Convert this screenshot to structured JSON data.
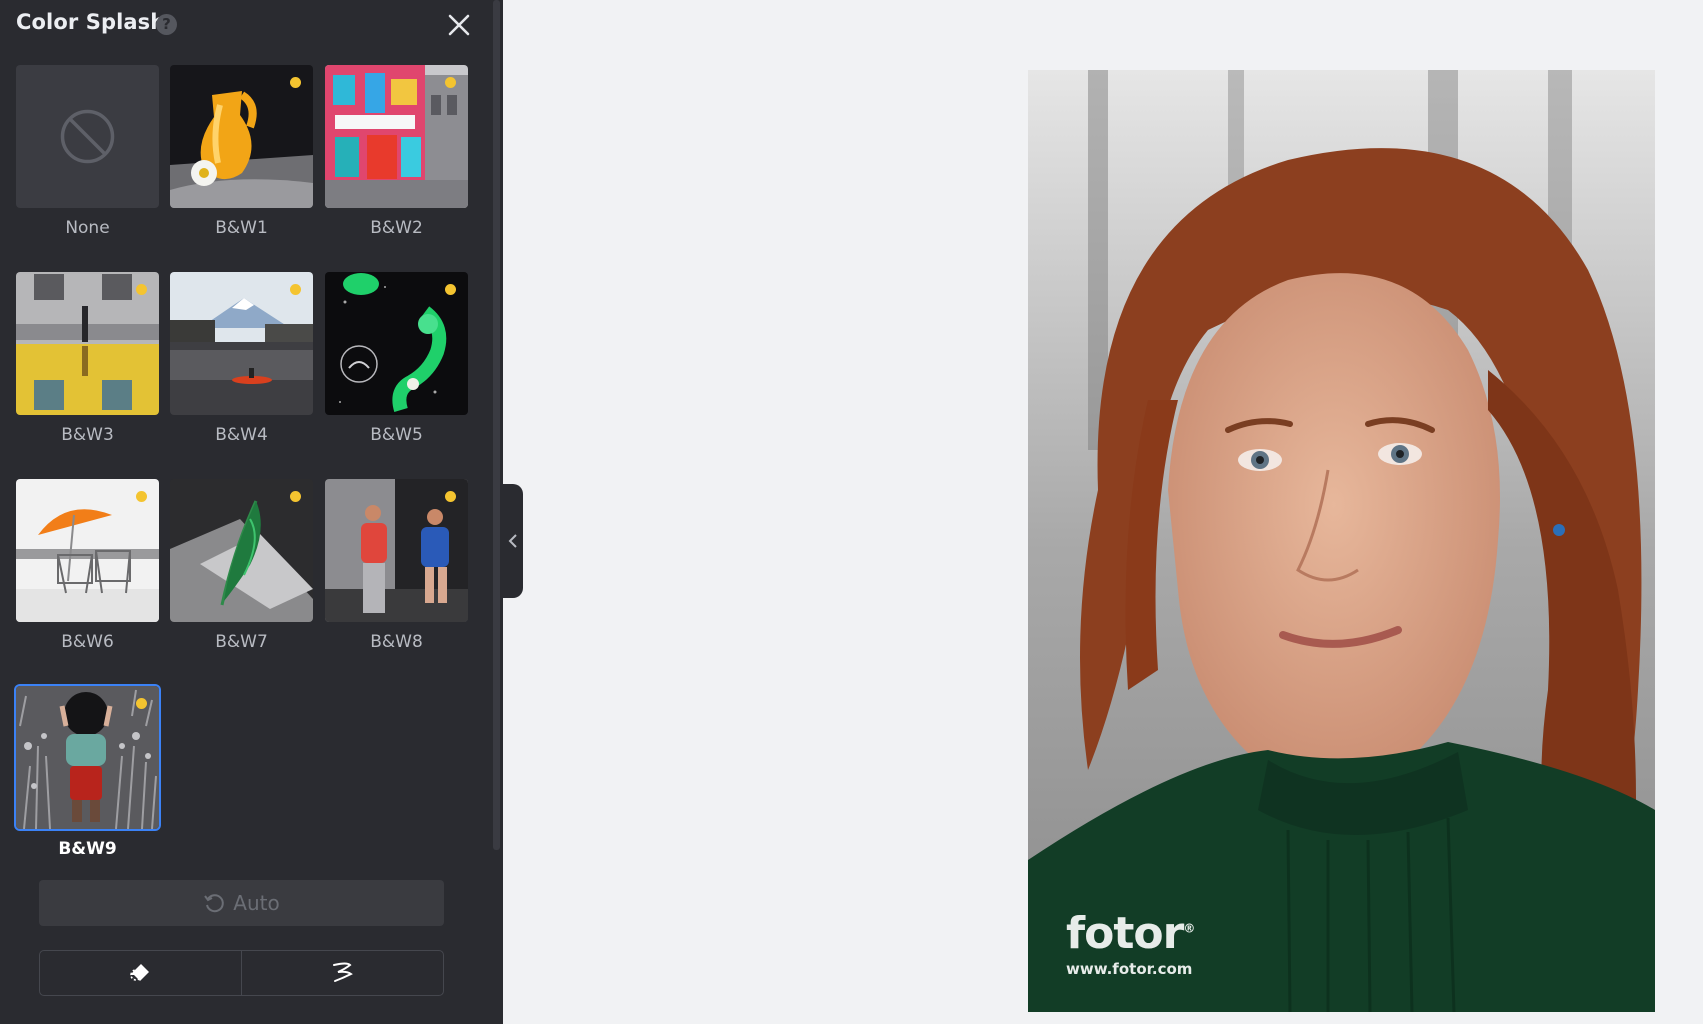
{
  "panel": {
    "title": "Color Splash",
    "help_icon": "question-mark-icon",
    "close_icon": "close-icon"
  },
  "presets": [
    {
      "label": "None",
      "premium": false,
      "selected": false,
      "icon": "none-icon"
    },
    {
      "label": "B&W1",
      "premium": true,
      "selected": false
    },
    {
      "label": "B&W2",
      "premium": true,
      "selected": false
    },
    {
      "label": "B&W3",
      "premium": true,
      "selected": false
    },
    {
      "label": "B&W4",
      "premium": true,
      "selected": false
    },
    {
      "label": "B&W5",
      "premium": true,
      "selected": false
    },
    {
      "label": "B&W6",
      "premium": true,
      "selected": false
    },
    {
      "label": "B&W7",
      "premium": true,
      "selected": false
    },
    {
      "label": "B&W8",
      "premium": true,
      "selected": false
    },
    {
      "label": "B&W9",
      "premium": true,
      "selected": true
    }
  ],
  "auto": {
    "label": "Auto",
    "icon": "refresh-icon"
  },
  "tools": {
    "eraser_icon": "eraser-icon",
    "brush_icon": "brush-icon"
  },
  "collapse": {
    "icon": "chevron-left-icon"
  },
  "canvas": {
    "watermark_logo": "fotor",
    "watermark_registered": "®",
    "watermark_url": "www.fotor.com"
  },
  "colors": {
    "panel_bg": "#2a2b30",
    "canvas_bg": "#f1f2f4",
    "premium_dot": "#f4c430",
    "selection": "#3b82f6"
  }
}
